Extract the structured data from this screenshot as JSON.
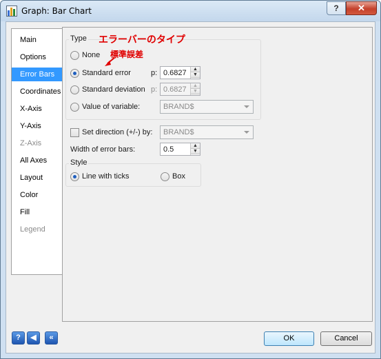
{
  "window": {
    "title": "Graph: Bar Chart",
    "help_label": "?",
    "close_label": "✕"
  },
  "sidebar": {
    "items": [
      {
        "label": "Main",
        "state": "normal"
      },
      {
        "label": "Options",
        "state": "normal"
      },
      {
        "label": "Error Bars",
        "state": "active"
      },
      {
        "label": "Coordinates",
        "state": "normal"
      },
      {
        "label": "X-Axis",
        "state": "normal"
      },
      {
        "label": "Y-Axis",
        "state": "normal"
      },
      {
        "label": "Z-Axis",
        "state": "disabled"
      },
      {
        "label": "All Axes",
        "state": "normal"
      },
      {
        "label": "Layout",
        "state": "normal"
      },
      {
        "label": "Color",
        "state": "normal"
      },
      {
        "label": "Fill",
        "state": "normal"
      },
      {
        "label": "Legend",
        "state": "disabled"
      }
    ]
  },
  "type_group": {
    "title": "Type",
    "options": {
      "none": "None",
      "standard_error": "Standard error",
      "standard_deviation": "Standard deviation",
      "value_of_variable": "Value of variable:"
    },
    "selected": "standard_error",
    "p_label": "p:",
    "p_label_disabled": "p:",
    "p_standard_error": "0.6827",
    "p_standard_deviation": "0.6827",
    "variable_value": "BRAND$"
  },
  "direction": {
    "label": "Set direction (+/-) by:",
    "checked": false,
    "value": "BRAND$"
  },
  "width": {
    "label": "Width of error bars:",
    "value": "0.5"
  },
  "style_group": {
    "title": "Style",
    "options": {
      "line_with_ticks": "Line with ticks",
      "box": "Box"
    },
    "selected": "line_with_ticks"
  },
  "annotations": {
    "heading": "エラーバーのタイプ",
    "callout": "標準誤差",
    "color": "#e00000"
  },
  "buttons": {
    "ok": "OK",
    "cancel": "Cancel",
    "help": "?",
    "back": "◀",
    "first": "«"
  },
  "colors": {
    "accent": "#3399ff",
    "titlebar": "#c3d7ec"
  }
}
